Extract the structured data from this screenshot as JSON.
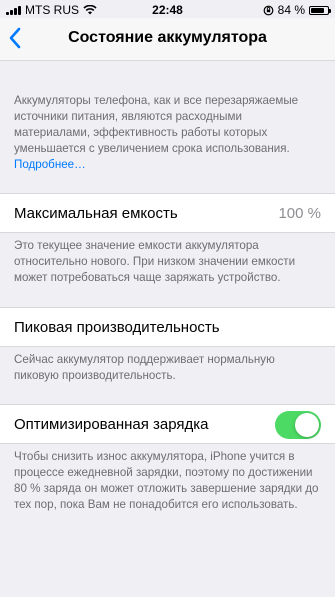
{
  "status_bar": {
    "carrier": "MTS RUS",
    "time": "22:48",
    "battery_percent": "84 %",
    "battery_level": 0.84
  },
  "nav": {
    "title": "Состояние аккумулятора"
  },
  "intro": {
    "text": "Аккумуляторы телефона, как и все перезаряжаемые источники питания, являются расходными материалами, эффективность работы которых уменьшается с увеличением срока использования.",
    "more_link": "Подробнее…"
  },
  "max_capacity": {
    "label": "Максимальная емкость",
    "value": "100 %",
    "description": "Это текущее значение емкости аккумулятора относительно нового. При низком значении емкости может потребоваться чаще заряжать устройство."
  },
  "peak_performance": {
    "label": "Пиковая производительность",
    "description": "Сейчас аккумулятор поддерживает нормальную пиковую производительность."
  },
  "optimized_charging": {
    "label": "Оптимизированная зарядка",
    "enabled": true,
    "description": "Чтобы снизить износ аккумулятора, iPhone учится в процессе ежедневной зарядки, поэтому по достижении 80 % заряда он может отложить завершение зарядки до тех пор, пока Вам не понадобится его использовать."
  },
  "colors": {
    "accent": "#007aff",
    "toggle_on": "#4cd964",
    "background": "#efeff4"
  }
}
